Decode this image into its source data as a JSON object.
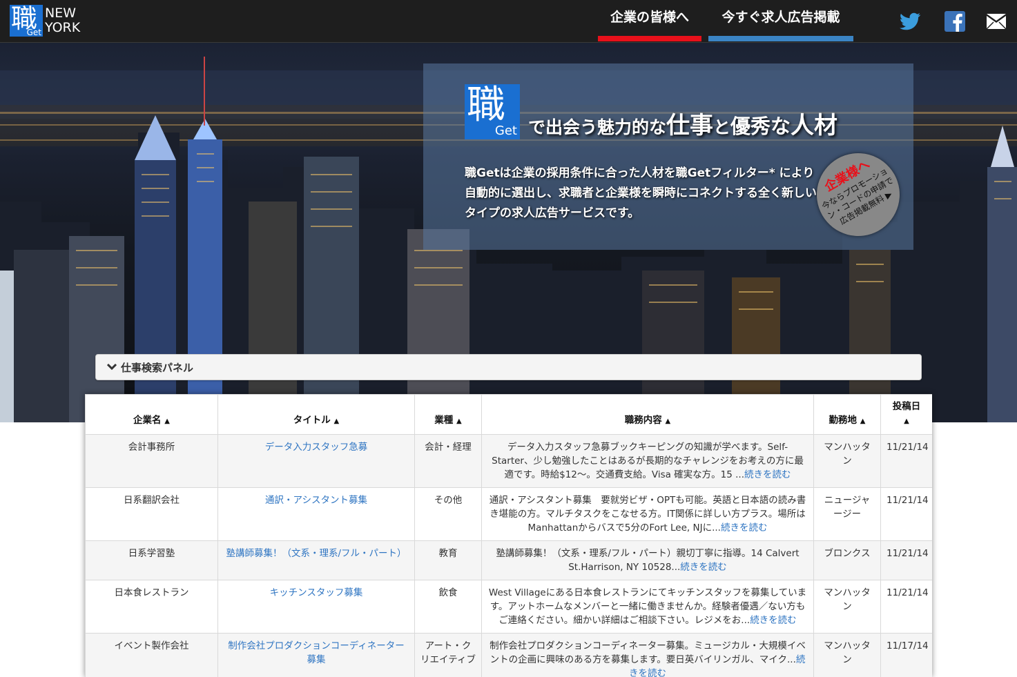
{
  "header": {
    "logo": {
      "kanji": "職",
      "get": "Get",
      "line1": "NEW",
      "line2": "YORK"
    },
    "nav": [
      {
        "label": "企業の皆様へ",
        "accent": "#e8101a"
      },
      {
        "label": "今すぐ求人広告掲載",
        "accent": "#3b84c4"
      }
    ],
    "social": [
      "twitter-icon",
      "facebook-icon",
      "mail-icon"
    ]
  },
  "hero": {
    "logo": {
      "kanji": "職",
      "get": "Get"
    },
    "tagline": {
      "p1": "で出会う魅力的な",
      "p2": "仕事",
      "p3": "と",
      "p4": "優秀な",
      "p5": "人材"
    },
    "description": "職Getは企業の採用条件に合った人材を職Getフィルター* により自動的に選出し、求職者と企業様を瞬時にコネクトする全く新しいタイプの求人広告サービスです。",
    "badge": {
      "title": "企業様へ",
      "body": "今ならプロモーション・コードの申請で広告掲載無料 ▶"
    }
  },
  "search_panel": {
    "label": "仕事検索パネル"
  },
  "table": {
    "headers": [
      {
        "label": "企業名"
      },
      {
        "label": "タイトル"
      },
      {
        "label": "業種"
      },
      {
        "label": "職務内容"
      },
      {
        "label": "勤務地"
      },
      {
        "label": "投稿日"
      }
    ],
    "readmore": "続きを読む",
    "rows": [
      {
        "company": "会計事務所",
        "title": "データ入力スタッフ急募",
        "industry": "会計・経理",
        "desc": "データ入力スタッフ急募ブックキーピングの知識が学べます。Self-Starter、少し勉強したことはあるが長期的なチャレンジをお考えの方に最適です。時給$12〜。交通費支給。Visa 確実な方。15 ...",
        "location": "マンハッタン",
        "date": "11/21/14"
      },
      {
        "company": "日系翻訳会社",
        "title": "通訳・アシスタント募集",
        "industry": "その他",
        "desc": "通訳・アシスタント募集　要就労ビザ・OPTも可能。英語と日本語の読み書き堪能の方。マルチタスクをこなせる方。IT関係に詳しい方プラス。場所はManhattanからバスで5分のFort Lee, NJに...",
        "location": "ニュージャージー",
        "date": "11/21/14"
      },
      {
        "company": "日系学習塾",
        "title": "塾講師募集！（文系・理系/フル・パート）",
        "industry": "教育",
        "desc": "塾講師募集！（文系・理系/フル・パート）親切丁寧に指導。14 Calvert St.Harrison, NY 10528...",
        "location": "ブロンクス",
        "date": "11/21/14"
      },
      {
        "company": "日本食レストラン",
        "title": "キッチンスタッフ募集",
        "industry": "飲食",
        "desc": "West Villageにある日本食レストランにてキッチンスタッフを募集しています。アットホームなメンバーと一緒に働きませんか。経験者優遇／ない方もご連絡ください。細かい詳細はご相談下さい。レジメをお...",
        "location": "マンハッタン",
        "date": "11/21/14"
      },
      {
        "company": "イベント製作会社",
        "title": "制作会社プロダクションコーディネーター募集",
        "industry": "アート・クリエイティブ",
        "desc": "制作会社プロダクションコーディネーター募集。ミュージカル・大規模イベントの企画に興味のある方を募集します。要日英バイリンガル、マイク...",
        "location": "マンハッタン",
        "date": "11/17/14"
      }
    ]
  }
}
